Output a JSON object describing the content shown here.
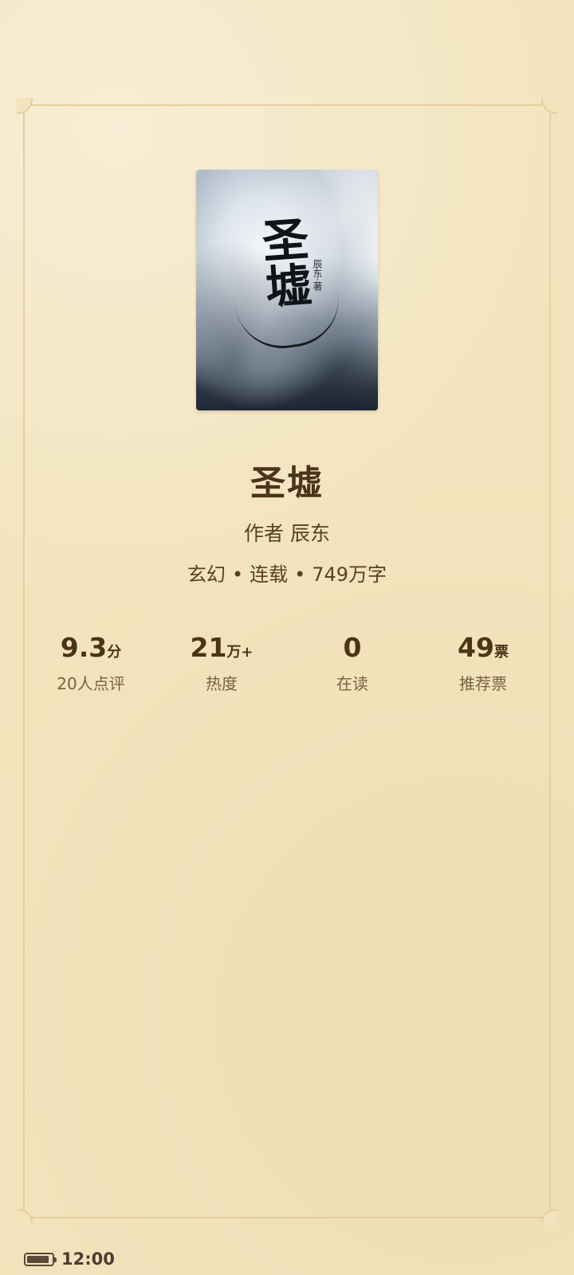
{
  "book": {
    "cover_title": "圣墟",
    "cover_author": "辰东·著",
    "title": "圣墟",
    "author_prefix": "作者",
    "author": "辰东",
    "genre": "玄幻",
    "status": "连载",
    "word_count": "749万字",
    "separator": "•"
  },
  "stats": [
    {
      "value": "9.3",
      "unit": "分",
      "label": "20人点评"
    },
    {
      "value": "21",
      "unit": "万+",
      "label": "热度"
    },
    {
      "value": "0",
      "unit": "",
      "label": "在读"
    },
    {
      "value": "49",
      "unit": "票",
      "label": "推荐票"
    }
  ],
  "status_bar": {
    "time": "12:00",
    "battery_level": 0.9
  },
  "colors": {
    "background": "#f3e4bd",
    "frame": "#e6cfa0",
    "text_primary": "#4d3318",
    "text_secondary": "#7b6142"
  }
}
